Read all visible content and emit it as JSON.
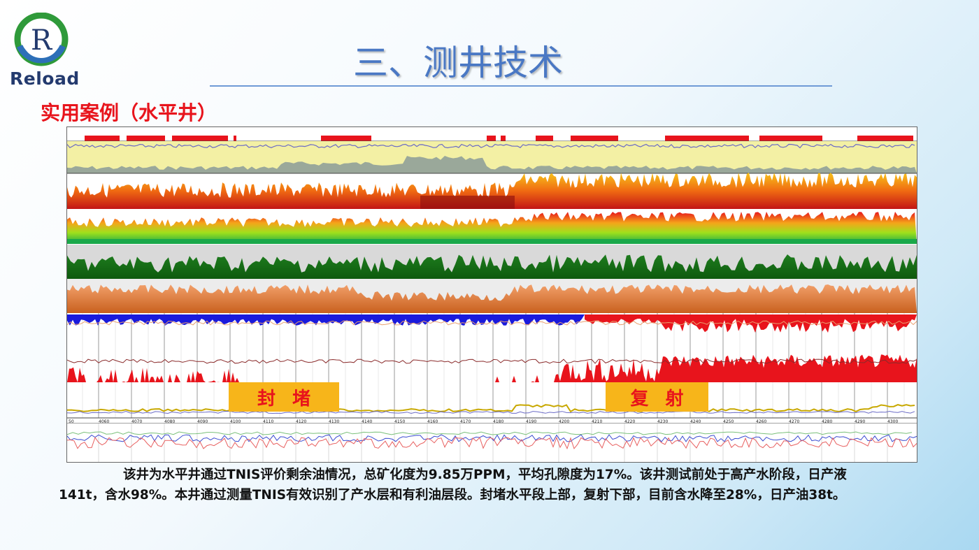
{
  "brand": {
    "logo_letter": "R",
    "name": "Reload",
    "colors": {
      "ring_green": "#2f9a3a",
      "ring_blue": "#2d6fb8",
      "letter": "#233a6e"
    }
  },
  "header": {
    "title": "三、测井技术",
    "subtitle": "实用案例（水平井）"
  },
  "log_panel": {
    "depth_ticks": [
      "50",
      "4060",
      "4070",
      "4080",
      "4090",
      "4100",
      "4110",
      "4120",
      "4130",
      "4140",
      "4150",
      "4160",
      "4170",
      "4180",
      "4190",
      "4200",
      "4210",
      "4220",
      "4230",
      "4240",
      "4250",
      "4260",
      "4270",
      "4280",
      "4290",
      "4300"
    ],
    "annotations": {
      "seal": "封堵",
      "reperforate": "复射"
    },
    "colors": {
      "seal_tag": "#f7b51a",
      "tag_text": "#e8141c",
      "track1_fill": "#f3f0a4",
      "oil": "#e8141c",
      "water": "#1a1adc",
      "green": "#1e7d1e",
      "orange": "#e07a2c"
    }
  },
  "caption": {
    "line1": "该井为水平井通过TNIS评价剩余油情况，总矿化度为9.85万PPM，平均孔隙度为17%。该井测试前处于高产水阶段，日产液",
    "line2": "141t，含水98%。本井通过测量TNIS有效识别了产水层和有利油层段。封堵水平段上部，复射下部，目前含水降至28%，日产油38t。"
  }
}
